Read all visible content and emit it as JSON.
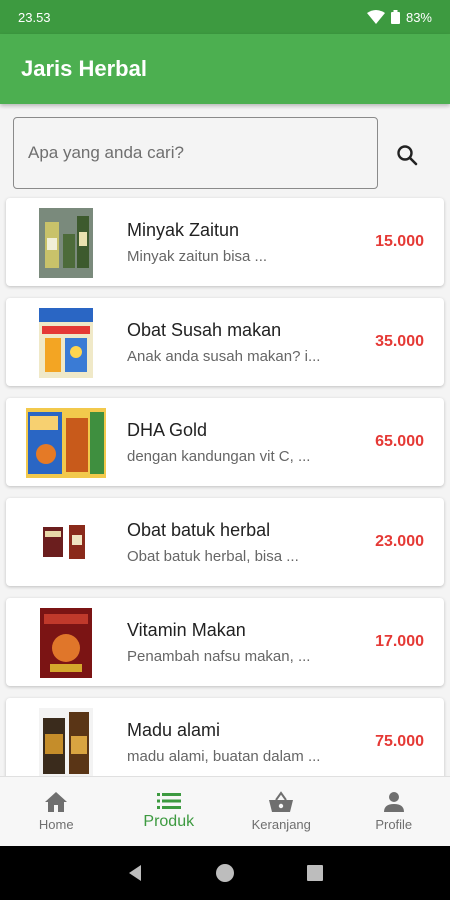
{
  "status": {
    "time": "23.53",
    "battery": "83%"
  },
  "app": {
    "title": "Jaris Herbal"
  },
  "search": {
    "placeholder": "Apa yang anda cari?",
    "value": ""
  },
  "products": [
    {
      "name": "Minyak Zaitun",
      "desc": "Minyak zaitun bisa ...",
      "price": "15.000"
    },
    {
      "name": "Obat Susah makan",
      "desc": "Anak anda susah makan? i...",
      "price": "35.000"
    },
    {
      "name": "DHA Gold",
      "desc": "dengan kandungan vit C, ...",
      "price": "65.000"
    },
    {
      "name": "Obat batuk herbal",
      "desc": "Obat batuk herbal, bisa ...",
      "price": "23.000"
    },
    {
      "name": "Vitamin Makan",
      "desc": "Penambah nafsu makan, ...",
      "price": "17.000"
    },
    {
      "name": "Madu alami",
      "desc": "madu alami, buatan dalam ...",
      "price": "75.000"
    }
  ],
  "nav": {
    "home": "Home",
    "produk": "Produk",
    "keranjang": "Keranjang",
    "profile": "Profile"
  },
  "colors": {
    "primary": "#4caf50",
    "statusbar": "#3d9a40",
    "price": "#e53935"
  }
}
